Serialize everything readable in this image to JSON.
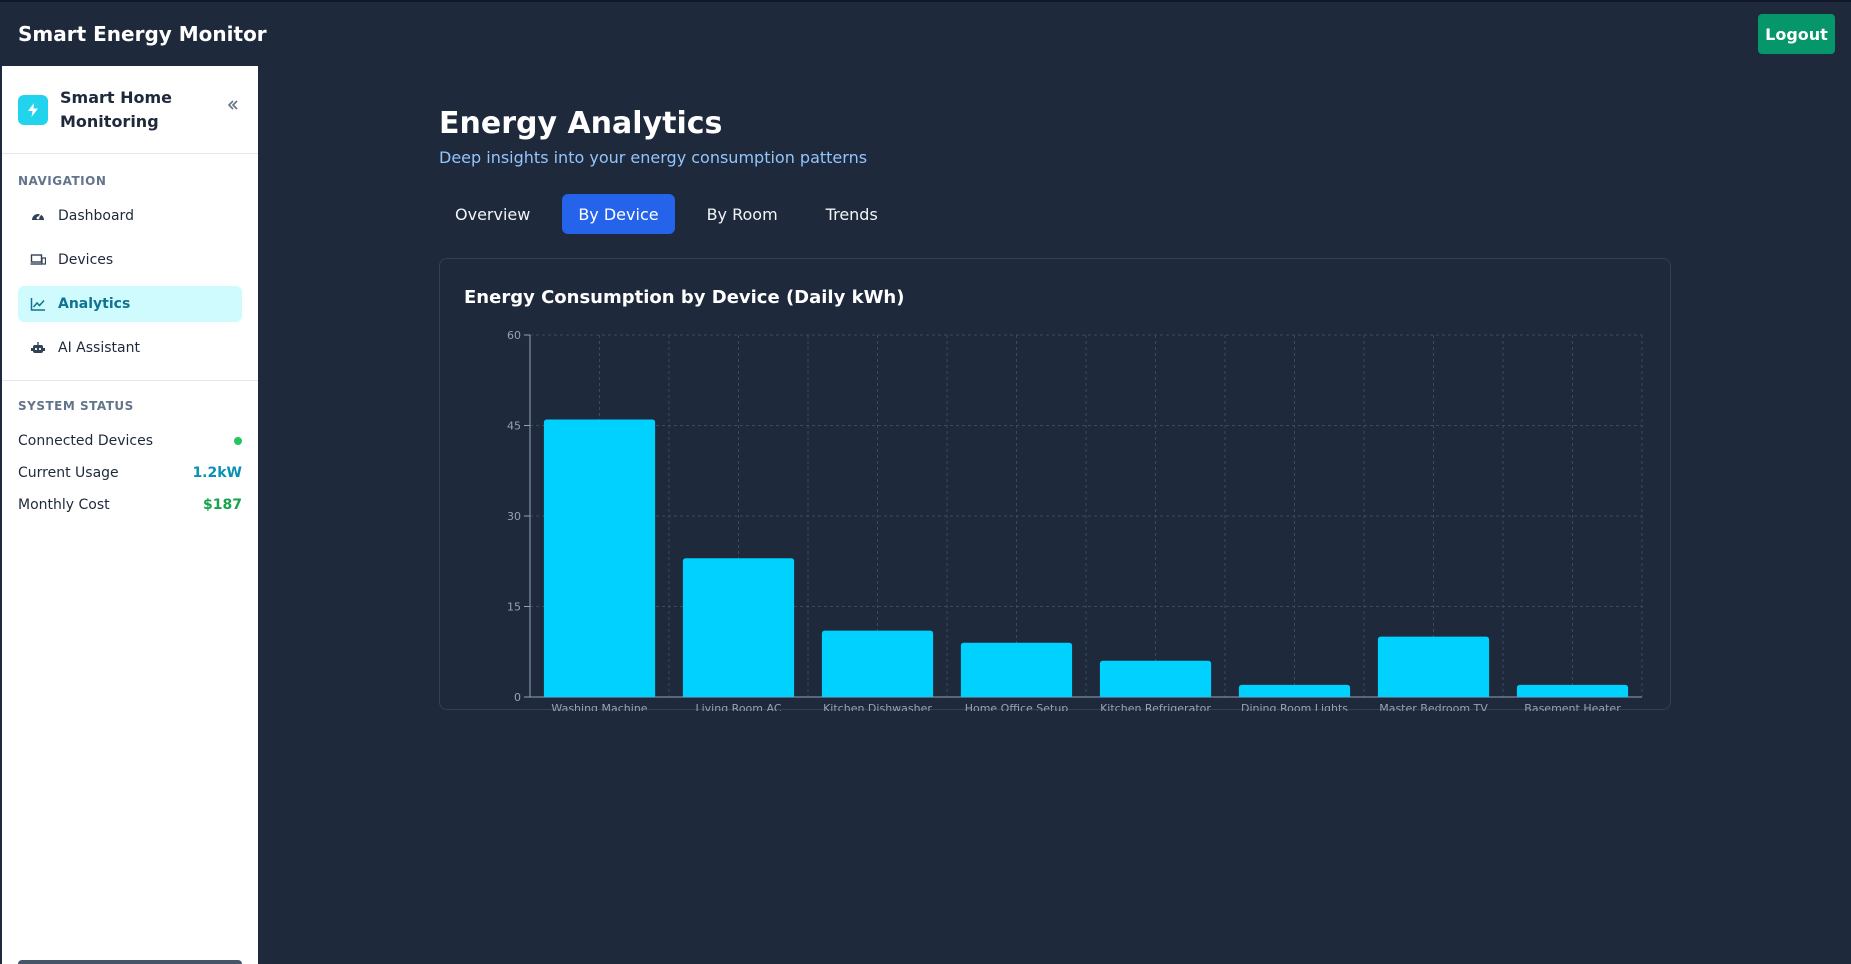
{
  "app": {
    "title": "Smart Energy Monitor",
    "logout_label": "Logout"
  },
  "sidebar": {
    "brand": "Smart Home Monitoring",
    "collapse_icon": "chevrons-left-icon",
    "nav_label": "NAVIGATION",
    "items": [
      {
        "label": "Dashboard",
        "icon": "gauge-icon",
        "active": false
      },
      {
        "label": "Devices",
        "icon": "devices-icon",
        "active": false
      },
      {
        "label": "Analytics",
        "icon": "chart-line-icon",
        "active": true
      },
      {
        "label": "AI Assistant",
        "icon": "robot-icon",
        "active": false
      }
    ],
    "status_label": "SYSTEM STATUS",
    "status": {
      "connected_label": "Connected Devices",
      "usage_label": "Current Usage",
      "usage_value": "1.2kW",
      "cost_label": "Monthly Cost",
      "cost_value": "$187"
    }
  },
  "main": {
    "title": "Energy Analytics",
    "subtitle": "Deep insights into your energy consumption patterns",
    "tabs": [
      {
        "label": "Overview",
        "active": false
      },
      {
        "label": "By Device",
        "active": true
      },
      {
        "label": "By Room",
        "active": false
      },
      {
        "label": "Trends",
        "active": false
      }
    ],
    "chart_title": "Energy Consumption by Device (Daily kWh)"
  },
  "colors": {
    "bar": "#00d1ff",
    "active_tab": "#2563eb",
    "logout": "#059669",
    "accent": "#22d3ee"
  },
  "chart_data": {
    "type": "bar",
    "title": "Energy Consumption by Device (Daily kWh)",
    "categories": [
      "Washing Machine",
      "Living Room AC",
      "Kitchen Dishwasher",
      "Home Office Setup",
      "Kitchen Refrigerator",
      "Dining Room Lights",
      "Master Bedroom TV",
      "Basement Heater"
    ],
    "values": [
      46,
      23,
      11,
      9,
      6,
      2,
      10,
      2
    ],
    "ylim": [
      0,
      60
    ],
    "yticks": [
      0,
      15,
      30,
      45,
      60
    ],
    "grid": true
  }
}
